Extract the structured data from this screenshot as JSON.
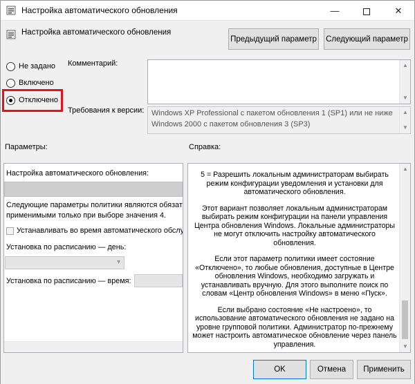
{
  "window": {
    "title": "Настройка автоматического обновления",
    "min_glyph": "—",
    "close_glyph": "✕"
  },
  "header": {
    "policy_name": "Настройка автоматического обновления",
    "prev_button": "Предыдущий параметр",
    "next_button": "Следующий параметр"
  },
  "state": {
    "options": [
      {
        "label": "Не задано",
        "checked": false
      },
      {
        "label": "Включено",
        "checked": false
      },
      {
        "label": "Отключено",
        "checked": true
      }
    ]
  },
  "comment": {
    "label": "Комментарий:",
    "value": ""
  },
  "requirements": {
    "label": "Требования к версии:",
    "lines": [
      "Windows XP Professional с пакетом обновления 1 (SP1) или не ниже",
      "Windows 2000 с пакетом обновления 3 (SP3)"
    ]
  },
  "sections": {
    "options_label": "Параметры:",
    "help_label": "Справка:"
  },
  "options_panel": {
    "configure_label": "Настройка автоматического обновления:",
    "note_line1": "Следующие параметры политики являются обязатель",
    "note_line2": "применимыми только при выборе значения 4.",
    "install_during_maintenance": "Устанавливать во время автоматического обслужи",
    "schedule_day_label": "Установка по расписанию — день:",
    "schedule_time_label": "Установка по расписанию — время:"
  },
  "help": {
    "paragraphs": [
      "5 = Разрешить локальным администраторам выбирать режим конфигурации уведомления и установки для автоматического обновления.",
      "Этот вариант позволяет локальным администраторам выбирать режим конфигурации на панели управления Центра обновления Windows. Локальные администраторы не могут отключить настройку автоматического обновления.",
      "Если этот параметр политики имеет состояние «Отключено», то любые обновления, доступные в Центре обновления Windows, необходимо загружать и устанавливать вручную. Для этого выполните поиск по словам «Центр обновления Windows» в меню «Пуск».",
      "Если выбрано состояние «Не настроено», то использование автоматического обновления не задано на уровне групповой политики. Администратор по-прежнему может настроить автоматическое обновление через панель управления."
    ]
  },
  "footer": {
    "ok": "OK",
    "cancel": "Отмена",
    "apply": "Применить"
  },
  "colors": {
    "highlight_frame": "#e3121c",
    "ok_border": "#0078d7"
  }
}
